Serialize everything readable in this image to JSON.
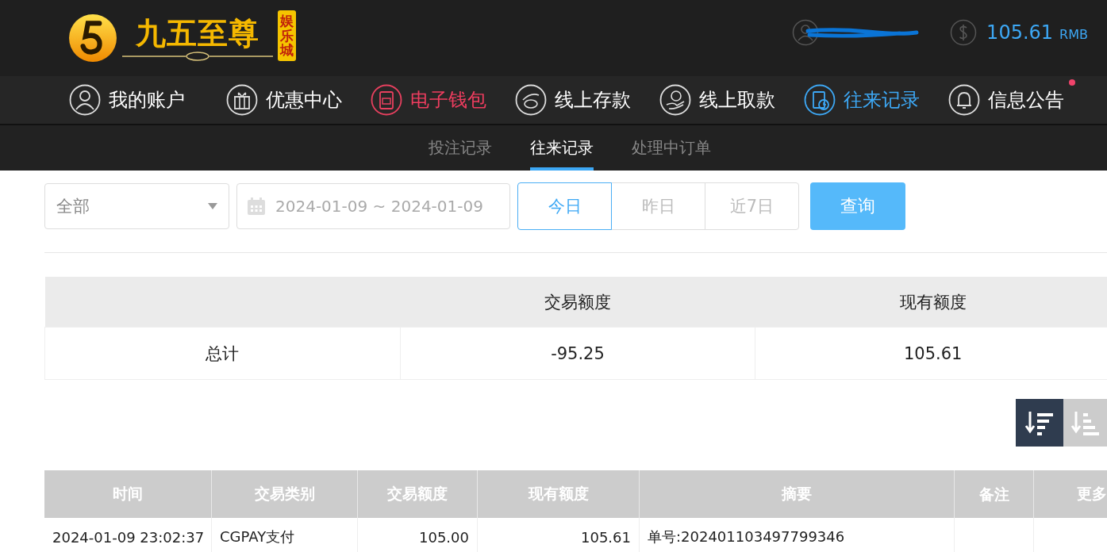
{
  "header": {
    "logo": {
      "title": "九五至尊",
      "tag": "娱乐城"
    },
    "balance": {
      "amount": "105.61",
      "currency": "RMB"
    }
  },
  "nav": [
    {
      "label": "我的账户",
      "selected": false,
      "highlighted": false,
      "dot": false
    },
    {
      "label": "优惠中心",
      "selected": false,
      "highlighted": false,
      "dot": false
    },
    {
      "label": "电子钱包",
      "selected": false,
      "highlighted": true,
      "dot": false
    },
    {
      "label": "线上存款",
      "selected": false,
      "highlighted": false,
      "dot": false
    },
    {
      "label": "线上取款",
      "selected": false,
      "highlighted": false,
      "dot": false
    },
    {
      "label": "往来记录",
      "selected": true,
      "highlighted": false,
      "dot": false
    },
    {
      "label": "信息公告",
      "selected": false,
      "highlighted": false,
      "dot": true
    }
  ],
  "subtabs": [
    {
      "label": "投注记录",
      "selected": false
    },
    {
      "label": "往来记录",
      "selected": true
    },
    {
      "label": "处理中订单",
      "selected": false
    }
  ],
  "filters": {
    "type_select": "全部",
    "date_range": "2024-01-09 ~ 2024-01-09",
    "ranges": [
      {
        "label": "今日",
        "selected": true
      },
      {
        "label": "昨日",
        "selected": false
      },
      {
        "label": "近7日",
        "selected": false
      }
    ],
    "query_button": "查询"
  },
  "summary": {
    "columns": [
      "",
      "交易额度",
      "现有额度"
    ],
    "rows": [
      [
        "总计",
        "-95.25",
        "105.61"
      ]
    ]
  },
  "sort_buttons": [
    {
      "kind": "desc",
      "selected": true
    },
    {
      "kind": "asc",
      "selected": false
    }
  ],
  "table": {
    "columns": [
      "时间",
      "交易类别",
      "交易额度",
      "现有额度",
      "摘要",
      "备注",
      "更多"
    ],
    "rows": [
      [
        "2024-01-09 23:02:37",
        "CGPAY支付",
        "105.00",
        "105.61",
        "单号:202401103497799346",
        "",
        ""
      ]
    ]
  }
}
